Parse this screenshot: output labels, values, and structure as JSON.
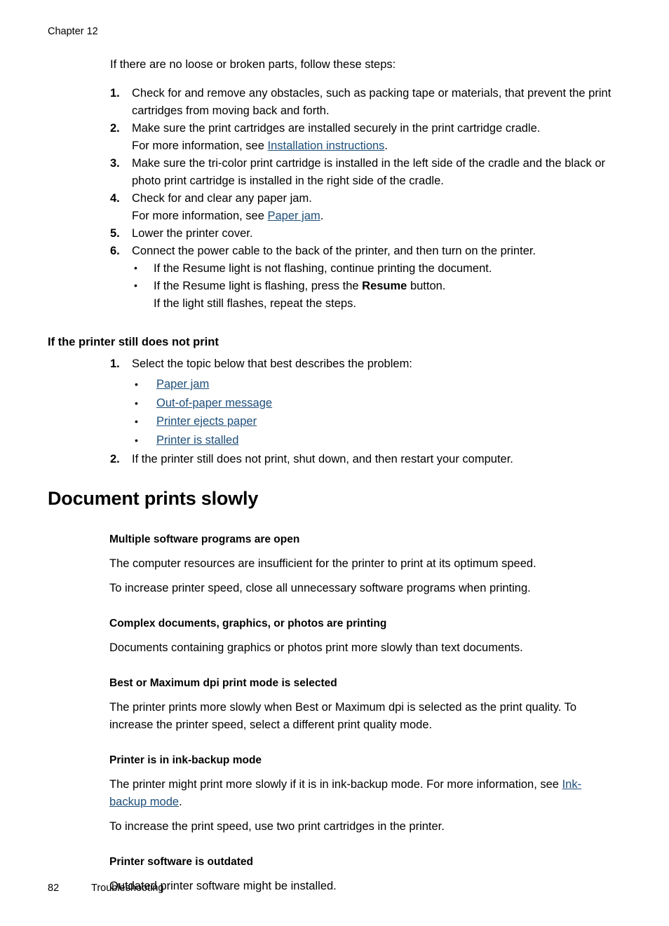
{
  "header": {
    "chapter": "Chapter 12"
  },
  "section_one": {
    "intro": "If there are no loose or broken parts, follow these steps:",
    "steps": [
      {
        "num": "1.",
        "lines": [
          "Check for and remove any obstacles, such as packing tape or materials, that prevent the print cartridges from moving back and forth."
        ]
      },
      {
        "num": "2.",
        "lines": [
          "Make sure the print cartridges are installed securely in the print cartridge cradle."
        ],
        "see_prefix": "For more information, see ",
        "see_link": "Installation instructions",
        "see_suffix": "."
      },
      {
        "num": "3.",
        "lines": [
          "Make sure the tri-color print cartridge is installed in the left side of the cradle and the black or photo print cartridge is installed in the right side of the cradle."
        ]
      },
      {
        "num": "4.",
        "lines": [
          "Check for and clear any paper jam."
        ],
        "see_prefix": "For more information, see ",
        "see_link": "Paper jam",
        "see_suffix": "."
      },
      {
        "num": "5.",
        "lines": [
          "Lower the printer cover."
        ]
      },
      {
        "num": "6.",
        "lines": [
          "Connect the power cable to the back of the printer, and then turn on the printer."
        ]
      }
    ],
    "step6_bullets": [
      {
        "text": "If the Resume light is not flashing, continue printing the document."
      },
      {
        "prefix": "If the Resume light is flashing, press the ",
        "bold": "Resume",
        "suffix": " button.",
        "followup": "If the light still flashes, repeat the steps."
      }
    ],
    "bullet_glyph": "•"
  },
  "section_two": {
    "heading": "If the printer still does not print",
    "step1_num": "1.",
    "step1_text": "Select the topic below that best describes the problem:",
    "links": [
      "Paper jam",
      "Out-of-paper message",
      "Printer ejects paper",
      "Printer is stalled"
    ],
    "step2_num": "2.",
    "step2_text": "If the printer still does not print, shut down, and then restart your computer."
  },
  "section_three": {
    "title": "Document prints slowly",
    "subsections": [
      {
        "heading": "Multiple software programs are open",
        "paragraphs": [
          "The computer resources are insufficient for the printer to print at its optimum speed.",
          "To increase printer speed, close all unnecessary software programs when printing."
        ]
      },
      {
        "heading": "Complex documents, graphics, or photos are printing",
        "paragraphs": [
          "Documents containing graphics or photos print more slowly than text documents."
        ]
      },
      {
        "heading": "Best or Maximum dpi print mode is selected",
        "paragraphs": [
          "The printer prints more slowly when Best or Maximum dpi is selected as the print quality. To increase the printer speed, select a different print quality mode."
        ]
      },
      {
        "heading": "Printer is in ink-backup mode",
        "para_prefix": "The printer might print more slowly if it is in ink-backup mode. For more information, see ",
        "para_link": "Ink-backup mode",
        "para_suffix": ".",
        "paragraphs": [
          "To increase the print speed, use two print cartridges in the printer."
        ]
      },
      {
        "heading": "Printer software is outdated",
        "paragraphs": [
          "Outdated printer software might be installed."
        ]
      }
    ]
  },
  "footer": {
    "page_number": "82",
    "section_name": "Troubleshooting"
  },
  "colors": {
    "link": "#1d4e79",
    "text": "#000000",
    "background": "#ffffff"
  }
}
